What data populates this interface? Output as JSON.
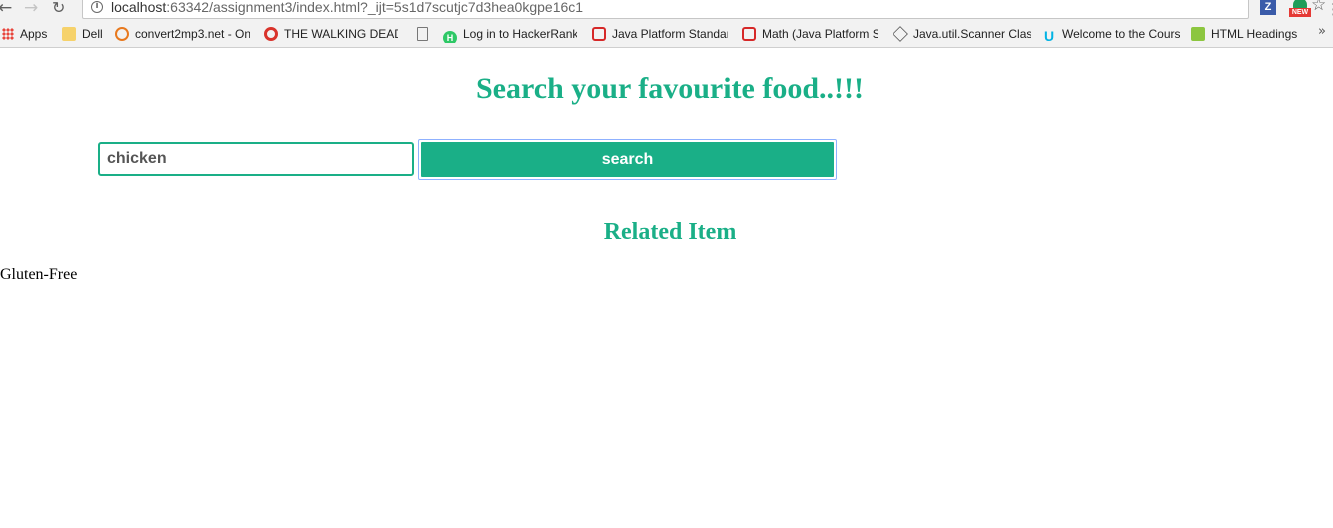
{
  "browser": {
    "url_host": "localhost",
    "url_rest": ":63342/assignment3/index.html?_ijt=5s1d7scutjc7d3hea0kgpe16c1",
    "extension_z_label": "Z",
    "extension_new_label": "NEW"
  },
  "bookmarks": [
    {
      "label": "Apps",
      "icon": "apps-icon"
    },
    {
      "label": "Dell",
      "icon": "folder-icon"
    },
    {
      "label": "convert2mp3.net - On",
      "icon": "convert-icon"
    },
    {
      "label": "THE WALKING DEAD:",
      "icon": "twd-icon"
    },
    {
      "label": "",
      "icon": "page-icon"
    },
    {
      "label": "Log in to HackerRank",
      "icon": "hackerrank-icon"
    },
    {
      "label": "Java Platform Standar",
      "icon": "oracle-icon"
    },
    {
      "label": "Math (Java Platform S",
      "icon": "oracle-icon"
    },
    {
      "label": "Java.util.Scanner Class",
      "icon": "diamond-icon"
    },
    {
      "label": "Welcome to the Cours",
      "icon": "udacity-icon"
    },
    {
      "label": "HTML Headings",
      "icon": "html-icon"
    }
  ],
  "page": {
    "title": "Search your favourite food..!!!",
    "search_value": "chicken",
    "search_button_label": "search",
    "related_heading": "Related Item",
    "results": [
      "Gluten-Free"
    ]
  },
  "colors": {
    "accent": "#1aaf87",
    "button_focus_border": "#8fb1ff"
  }
}
